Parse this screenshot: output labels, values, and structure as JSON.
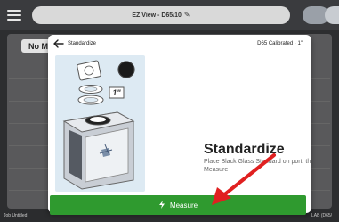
{
  "app_bar": {
    "title": "EZ View - D65/10",
    "pencil": "✎"
  },
  "background": {
    "chip_label": "No M",
    "footer_left": "Job Untitled",
    "footer_right": "LAB (D65/"
  },
  "modal": {
    "title": "Standardize",
    "status": "D65 Calibrated · 1\"",
    "heading": "Standardize",
    "description": "Place Black Glass Standard on port, then press Measure",
    "illustration_label": "1\""
  },
  "measure_button": {
    "label": "Measure"
  },
  "colors": {
    "accent_green": "#2f9a2f",
    "arrow_red": "#e02020",
    "illustration_bg": "#ddeaf3"
  }
}
